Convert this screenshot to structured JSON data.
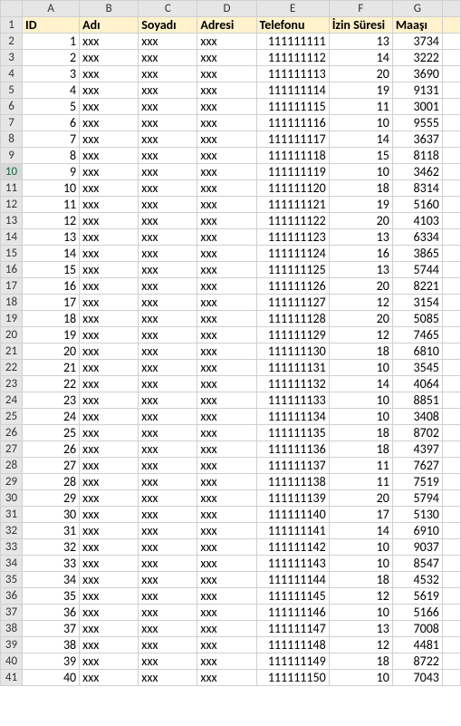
{
  "columns": [
    "A",
    "B",
    "C",
    "D",
    "E",
    "F",
    "G",
    ""
  ],
  "headers": {
    "A": "ID",
    "B": "Adı",
    "C": "Soyadı",
    "D": "Adresi",
    "E": "Telefonu",
    "F": "İzin Süresi",
    "G": "Maaşı"
  },
  "selected_row": 10,
  "rows": [
    {
      "id": 1,
      "ad": "xxx",
      "soyad": "xxx",
      "adres": "xxx",
      "tel": "111111111",
      "izin": 13,
      "maas": 3734
    },
    {
      "id": 2,
      "ad": "xxx",
      "soyad": "xxx",
      "adres": "xxx",
      "tel": "111111112",
      "izin": 14,
      "maas": 3222
    },
    {
      "id": 3,
      "ad": "xxx",
      "soyad": "xxx",
      "adres": "xxx",
      "tel": "111111113",
      "izin": 20,
      "maas": 3690
    },
    {
      "id": 4,
      "ad": "xxx",
      "soyad": "xxx",
      "adres": "xxx",
      "tel": "111111114",
      "izin": 19,
      "maas": 9131
    },
    {
      "id": 5,
      "ad": "xxx",
      "soyad": "xxx",
      "adres": "xxx",
      "tel": "111111115",
      "izin": 11,
      "maas": 3001
    },
    {
      "id": 6,
      "ad": "xxx",
      "soyad": "xxx",
      "adres": "xxx",
      "tel": "111111116",
      "izin": 10,
      "maas": 9555
    },
    {
      "id": 7,
      "ad": "xxx",
      "soyad": "xxx",
      "adres": "xxx",
      "tel": "111111117",
      "izin": 14,
      "maas": 3637
    },
    {
      "id": 8,
      "ad": "xxx",
      "soyad": "xxx",
      "adres": "xxx",
      "tel": "111111118",
      "izin": 15,
      "maas": 8118
    },
    {
      "id": 9,
      "ad": "xxx",
      "soyad": "xxx",
      "adres": "xxx",
      "tel": "111111119",
      "izin": 10,
      "maas": 3462
    },
    {
      "id": 10,
      "ad": "xxx",
      "soyad": "xxx",
      "adres": "xxx",
      "tel": "111111120",
      "izin": 18,
      "maas": 8314
    },
    {
      "id": 11,
      "ad": "xxx",
      "soyad": "xxx",
      "adres": "xxx",
      "tel": "111111121",
      "izin": 19,
      "maas": 5160
    },
    {
      "id": 12,
      "ad": "xxx",
      "soyad": "xxx",
      "adres": "xxx",
      "tel": "111111122",
      "izin": 20,
      "maas": 4103
    },
    {
      "id": 13,
      "ad": "xxx",
      "soyad": "xxx",
      "adres": "xxx",
      "tel": "111111123",
      "izin": 13,
      "maas": 6334
    },
    {
      "id": 14,
      "ad": "xxx",
      "soyad": "xxx",
      "adres": "xxx",
      "tel": "111111124",
      "izin": 16,
      "maas": 3865
    },
    {
      "id": 15,
      "ad": "xxx",
      "soyad": "xxx",
      "adres": "xxx",
      "tel": "111111125",
      "izin": 13,
      "maas": 5744
    },
    {
      "id": 16,
      "ad": "xxx",
      "soyad": "xxx",
      "adres": "xxx",
      "tel": "111111126",
      "izin": 20,
      "maas": 8221
    },
    {
      "id": 17,
      "ad": "xxx",
      "soyad": "xxx",
      "adres": "xxx",
      "tel": "111111127",
      "izin": 12,
      "maas": 3154
    },
    {
      "id": 18,
      "ad": "xxx",
      "soyad": "xxx",
      "adres": "xxx",
      "tel": "111111128",
      "izin": 20,
      "maas": 5085
    },
    {
      "id": 19,
      "ad": "xxx",
      "soyad": "xxx",
      "adres": "xxx",
      "tel": "111111129",
      "izin": 12,
      "maas": 7465
    },
    {
      "id": 20,
      "ad": "xxx",
      "soyad": "xxx",
      "adres": "xxx",
      "tel": "111111130",
      "izin": 18,
      "maas": 6810
    },
    {
      "id": 21,
      "ad": "xxx",
      "soyad": "xxx",
      "adres": "xxx",
      "tel": "111111131",
      "izin": 10,
      "maas": 3545
    },
    {
      "id": 22,
      "ad": "xxx",
      "soyad": "xxx",
      "adres": "xxx",
      "tel": "111111132",
      "izin": 14,
      "maas": 4064
    },
    {
      "id": 23,
      "ad": "xxx",
      "soyad": "xxx",
      "adres": "xxx",
      "tel": "111111133",
      "izin": 10,
      "maas": 8851
    },
    {
      "id": 24,
      "ad": "xxx",
      "soyad": "xxx",
      "adres": "xxx",
      "tel": "111111134",
      "izin": 10,
      "maas": 3408
    },
    {
      "id": 25,
      "ad": "xxx",
      "soyad": "xxx",
      "adres": "xxx",
      "tel": "111111135",
      "izin": 18,
      "maas": 8702
    },
    {
      "id": 26,
      "ad": "xxx",
      "soyad": "xxx",
      "adres": "xxx",
      "tel": "111111136",
      "izin": 18,
      "maas": 4397
    },
    {
      "id": 27,
      "ad": "xxx",
      "soyad": "xxx",
      "adres": "xxx",
      "tel": "111111137",
      "izin": 11,
      "maas": 7627
    },
    {
      "id": 28,
      "ad": "xxx",
      "soyad": "xxx",
      "adres": "xxx",
      "tel": "111111138",
      "izin": 11,
      "maas": 7519
    },
    {
      "id": 29,
      "ad": "xxx",
      "soyad": "xxx",
      "adres": "xxx",
      "tel": "111111139",
      "izin": 20,
      "maas": 5794
    },
    {
      "id": 30,
      "ad": "xxx",
      "soyad": "xxx",
      "adres": "xxx",
      "tel": "111111140",
      "izin": 17,
      "maas": 5130
    },
    {
      "id": 31,
      "ad": "xxx",
      "soyad": "xxx",
      "adres": "xxx",
      "tel": "111111141",
      "izin": 14,
      "maas": 6910
    },
    {
      "id": 32,
      "ad": "xxx",
      "soyad": "xxx",
      "adres": "xxx",
      "tel": "111111142",
      "izin": 10,
      "maas": 9037
    },
    {
      "id": 33,
      "ad": "xxx",
      "soyad": "xxx",
      "adres": "xxx",
      "tel": "111111143",
      "izin": 10,
      "maas": 8547
    },
    {
      "id": 34,
      "ad": "xxx",
      "soyad": "xxx",
      "adres": "xxx",
      "tel": "111111144",
      "izin": 18,
      "maas": 4532
    },
    {
      "id": 35,
      "ad": "xxx",
      "soyad": "xxx",
      "adres": "xxx",
      "tel": "111111145",
      "izin": 12,
      "maas": 5619
    },
    {
      "id": 36,
      "ad": "xxx",
      "soyad": "xxx",
      "adres": "xxx",
      "tel": "111111146",
      "izin": 10,
      "maas": 5166
    },
    {
      "id": 37,
      "ad": "xxx",
      "soyad": "xxx",
      "adres": "xxx",
      "tel": "111111147",
      "izin": 13,
      "maas": 7008
    },
    {
      "id": 38,
      "ad": "xxx",
      "soyad": "xxx",
      "adres": "xxx",
      "tel": "111111148",
      "izin": 12,
      "maas": 4481
    },
    {
      "id": 39,
      "ad": "xxx",
      "soyad": "xxx",
      "adres": "xxx",
      "tel": "111111149",
      "izin": 18,
      "maas": 8722
    },
    {
      "id": 40,
      "ad": "xxx",
      "soyad": "xxx",
      "adres": "xxx",
      "tel": "111111150",
      "izin": 10,
      "maas": 7043
    }
  ]
}
